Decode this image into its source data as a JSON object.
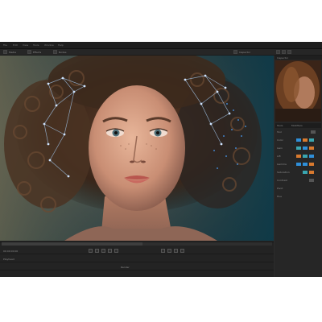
{
  "menubar": {
    "items": [
      "File",
      "Edit",
      "View",
      "Tools",
      "Window",
      "Help"
    ]
  },
  "toolbar": {
    "labels": [
      "Media",
      "Effects",
      "Nodes",
      "Inspector"
    ]
  },
  "viewer": {
    "zoom_label": "Fit"
  },
  "panel": {
    "header": "Inspector",
    "tabs": [
      "Tools",
      "Modifiers"
    ],
    "rows": [
      "Tool",
      "Color",
      "Gain",
      "Lift",
      "Gamma",
      "Saturation",
      "Contrast",
      "Pivot",
      "Hue"
    ]
  },
  "timeline": {
    "timecode": "00:00:00:00",
    "labels": [
      "Playhead",
      "Render"
    ]
  },
  "colors": {
    "accent_blue": "#2f8fd9",
    "accent_orange": "#d97a2f",
    "accent_teal": "#3aa6b0"
  },
  "progress": {
    "scrub_fraction": 0.52
  }
}
